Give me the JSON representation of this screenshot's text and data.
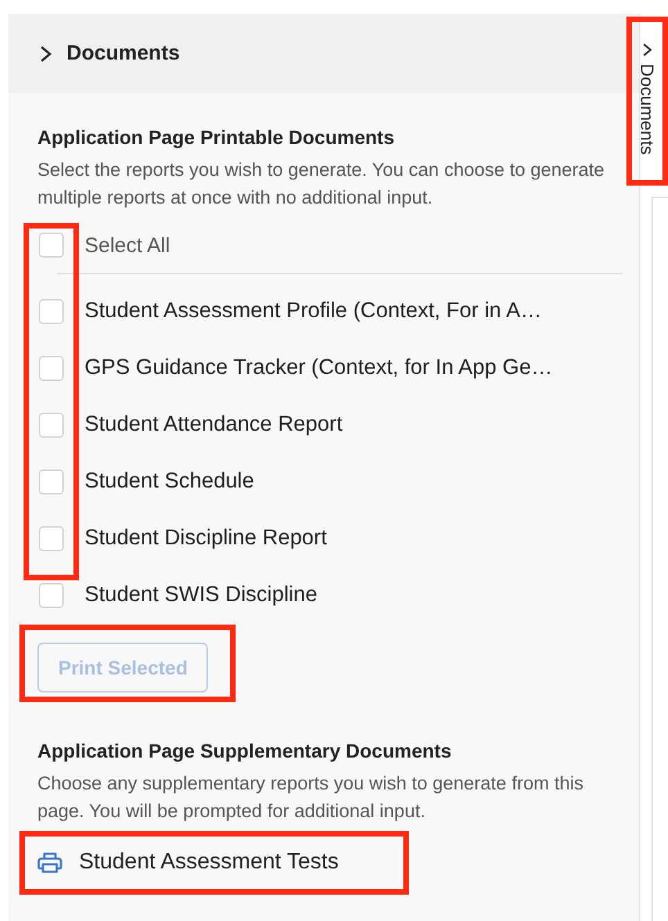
{
  "panel": {
    "title": "Documents",
    "expanded": false
  },
  "side_tab": {
    "label": "Documents",
    "expanded": false,
    "highlighted": true
  },
  "printable": {
    "heading": "Application Page Printable Documents",
    "description": "Select the reports you wish to generate. You can choose to generate multiple reports at once with no additional input.",
    "select_all": {
      "label": "Select All",
      "checked": false
    },
    "checkboxes_highlighted": true,
    "items": [
      {
        "label": "Student Assessment Profile (Context, For in A…",
        "checked": false
      },
      {
        "label": "GPS Guidance Tracker (Context, for In App Ge…",
        "checked": false
      },
      {
        "label": "Student Attendance Report",
        "checked": false
      },
      {
        "label": "Student Schedule",
        "checked": false
      },
      {
        "label": "Student Discipline Report",
        "checked": false
      },
      {
        "label": "Student SWIS Discipline",
        "checked": false
      }
    ],
    "print_button": {
      "label": "Print Selected",
      "disabled": true,
      "highlighted": true
    }
  },
  "supplementary": {
    "heading": "Application Page Supplementary Documents",
    "description": "Choose any supplementary reports you wish to generate from this page. You will be prompted for additional input.",
    "items_highlighted": true,
    "items": [
      {
        "label": "Student Assessment Tests"
      }
    ]
  }
}
